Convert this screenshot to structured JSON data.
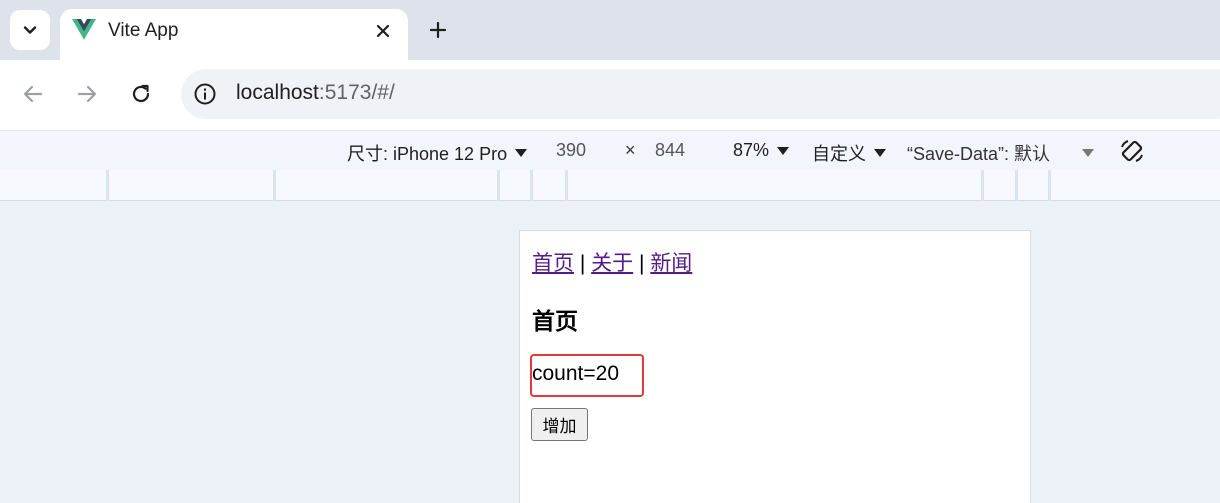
{
  "tab": {
    "title": "Vite App",
    "favicon": "vue-logo-icon",
    "colors": {
      "vue_green": "#41b883",
      "vue_dark": "#34495e"
    }
  },
  "omnibox": {
    "host": "localhost",
    "rest": ":5173/#/"
  },
  "device_toolbar": {
    "dimensions_label": "尺寸: iPhone 12 Pro",
    "width": "390",
    "times": "×",
    "height": "844",
    "zoom": "87%",
    "throttle": "自定义",
    "save_data": "“Save-Data”:  默认"
  },
  "page": {
    "nav": {
      "home": "首页",
      "sep": "|",
      "about": "关于",
      "news": "新闻"
    },
    "heading": "首页",
    "count_text": "count=20",
    "add_button": "增加"
  }
}
